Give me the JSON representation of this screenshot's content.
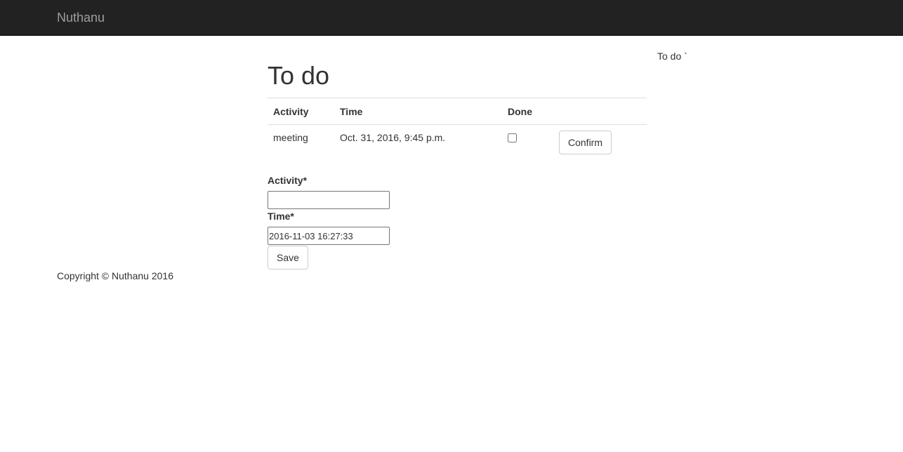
{
  "navbar": {
    "brand": "Nuthanu"
  },
  "sidebar": {
    "link_label": "To do `"
  },
  "main": {
    "title": "To do",
    "table": {
      "headers": [
        "Activity",
        "Time",
        "Done",
        ""
      ],
      "rows": [
        {
          "activity": "meeting",
          "time": "Oct. 31, 2016, 9:45 p.m.",
          "done": false,
          "action_label": "Confirm"
        }
      ]
    },
    "form": {
      "activity_label": "Activity*",
      "activity_value": "",
      "time_label": "Time*",
      "time_value": "2016-11-03 16:27:33",
      "save_label": "Save"
    }
  },
  "footer": {
    "copyright": "Copyright © Nuthanu 2016"
  },
  "colors": {
    "navbar_bg": "#222222",
    "brand_text": "#9d9d9d",
    "body_text": "#333333",
    "border": "#dddddd"
  }
}
